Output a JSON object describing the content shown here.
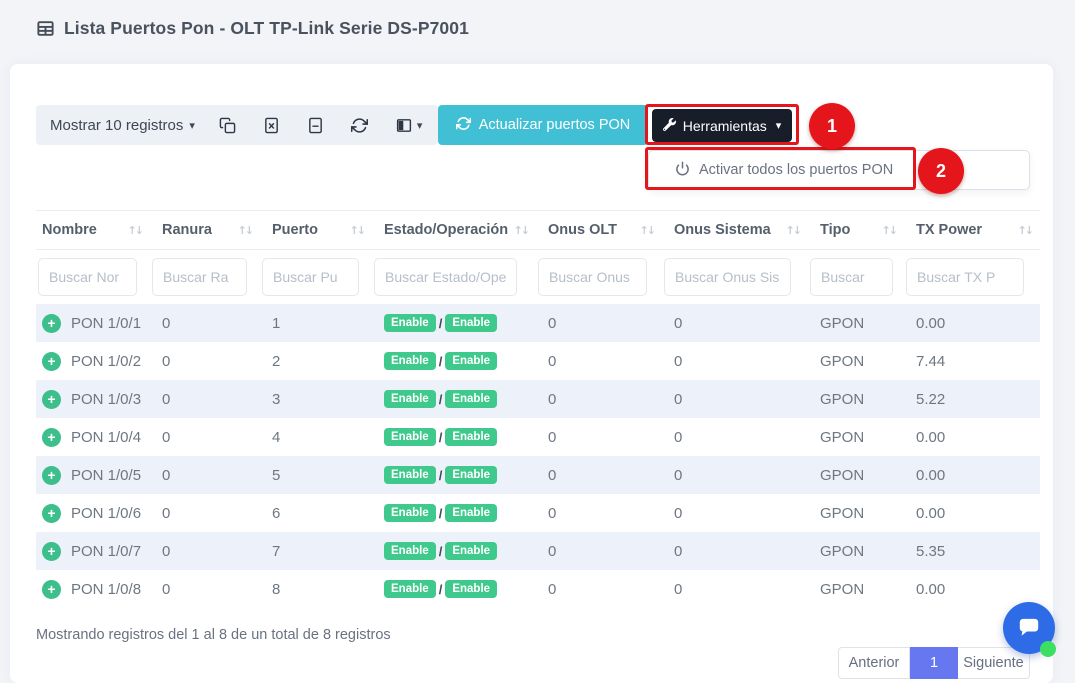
{
  "header": {
    "title": "Lista Puertos Pon - OLT TP-Link Serie DS-P7001"
  },
  "toolbar": {
    "length_label": "Mostrar 10 registros",
    "icons": [
      "copy",
      "excel-file",
      "file-text",
      "refresh",
      "columns"
    ],
    "update_label": "Actualizar puertos PON",
    "tools_label": "Herramientas"
  },
  "dropdown": {
    "item_label": "Activar todos los puertos PON"
  },
  "annotations": {
    "step1": "1",
    "step2": "2"
  },
  "glyphs": {
    "sort": "↑↓",
    "caret": "▾",
    "plus": "+"
  },
  "table": {
    "columns": [
      {
        "label": "Nombre",
        "placeholder": "Buscar Nor"
      },
      {
        "label": "Ranura",
        "placeholder": "Buscar Ra"
      },
      {
        "label": "Puerto",
        "placeholder": "Buscar Pu"
      },
      {
        "label": "Estado/Operación",
        "placeholder": "Buscar Estado/Ope"
      },
      {
        "label": "Onus OLT",
        "placeholder": "Buscar Onus"
      },
      {
        "label": "Onus Sistema",
        "placeholder": "Buscar Onus Sis"
      },
      {
        "label": "Tipo",
        "placeholder": "Buscar"
      },
      {
        "label": "TX Power",
        "placeholder": "Buscar TX P"
      }
    ],
    "badge_separator": "/",
    "rows": [
      {
        "name": "PON 1/0/1",
        "ranura": "0",
        "puerto": "1",
        "estado": "Enable",
        "operacion": "Enable",
        "onus_olt": "0",
        "onus_sistema": "0",
        "tipo": "GPON",
        "tx_power": "0.00"
      },
      {
        "name": "PON 1/0/2",
        "ranura": "0",
        "puerto": "2",
        "estado": "Enable",
        "operacion": "Enable",
        "onus_olt": "0",
        "onus_sistema": "0",
        "tipo": "GPON",
        "tx_power": "7.44"
      },
      {
        "name": "PON 1/0/3",
        "ranura": "0",
        "puerto": "3",
        "estado": "Enable",
        "operacion": "Enable",
        "onus_olt": "0",
        "onus_sistema": "0",
        "tipo": "GPON",
        "tx_power": "5.22"
      },
      {
        "name": "PON 1/0/4",
        "ranura": "0",
        "puerto": "4",
        "estado": "Enable",
        "operacion": "Enable",
        "onus_olt": "0",
        "onus_sistema": "0",
        "tipo": "GPON",
        "tx_power": "0.00"
      },
      {
        "name": "PON 1/0/5",
        "ranura": "0",
        "puerto": "5",
        "estado": "Enable",
        "operacion": "Enable",
        "onus_olt": "0",
        "onus_sistema": "0",
        "tipo": "GPON",
        "tx_power": "0.00"
      },
      {
        "name": "PON 1/0/6",
        "ranura": "0",
        "puerto": "6",
        "estado": "Enable",
        "operacion": "Enable",
        "onus_olt": "0",
        "onus_sistema": "0",
        "tipo": "GPON",
        "tx_power": "0.00"
      },
      {
        "name": "PON 1/0/7",
        "ranura": "0",
        "puerto": "7",
        "estado": "Enable",
        "operacion": "Enable",
        "onus_olt": "0",
        "onus_sistema": "0",
        "tipo": "GPON",
        "tx_power": "5.35"
      },
      {
        "name": "PON 1/0/8",
        "ranura": "0",
        "puerto": "8",
        "estado": "Enable",
        "operacion": "Enable",
        "onus_olt": "0",
        "onus_sistema": "0",
        "tipo": "GPON",
        "tx_power": "0.00"
      }
    ]
  },
  "footer": {
    "summary": "Mostrando registros del 1 al 8 de un total de 8 registros",
    "pagination": {
      "prev": "Anterior",
      "current": "1",
      "next": "Siguiente"
    }
  },
  "colors": {
    "accent_teal": "#41c0d5",
    "dark_button": "#181d2a",
    "annotation_red": "#e5151c",
    "badge_green": "#3fc98c",
    "row_stripe": "#edf1f9",
    "active_page": "#6777ef",
    "chat_blue": "#2d6ce6",
    "online_green": "#3ddf63"
  }
}
